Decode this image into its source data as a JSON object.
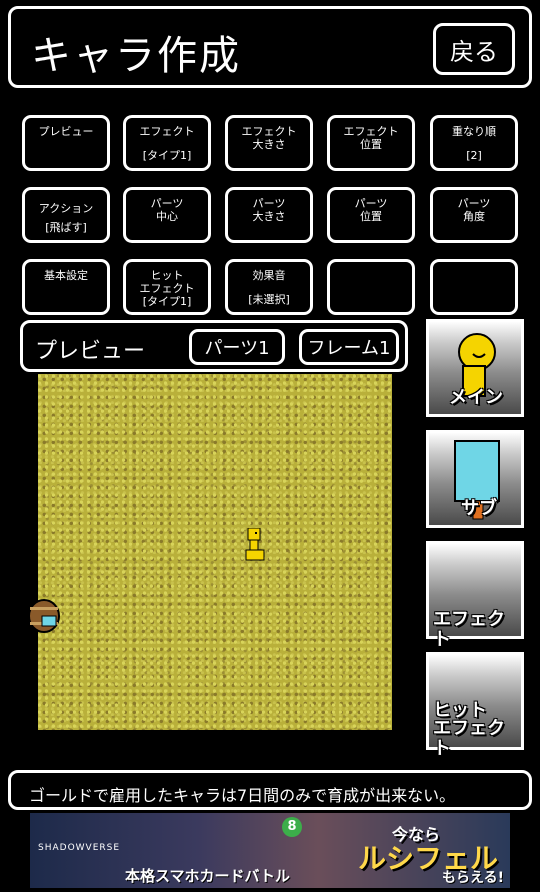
{
  "header": {
    "title": "キャラ作成",
    "back_label": "戻る"
  },
  "grid_buttons": [
    {
      "line1": "プレビュー",
      "line2": ""
    },
    {
      "line1": "エフェクト",
      "line2": "[タイプ1]"
    },
    {
      "line1": "エフェクト\n大きさ",
      "line2": ""
    },
    {
      "line1": "エフェクト\n位置",
      "line2": ""
    },
    {
      "line1": "重なり順",
      "line2": "[2]"
    },
    {
      "line1": "アクション",
      "line2": "[飛ばす]"
    },
    {
      "line1": "パーツ\n中心",
      "line2": ""
    },
    {
      "line1": "パーツ\n大きさ",
      "line2": ""
    },
    {
      "line1": "パーツ\n位置",
      "line2": ""
    },
    {
      "line1": "パーツ\n角度",
      "line2": ""
    },
    {
      "line1": "基本設定",
      "line2": ""
    },
    {
      "line1": "ヒット\nエフェクト",
      "line2": "[タイプ1]"
    },
    {
      "line1": "効果音",
      "line2": "[未選択]"
    },
    {
      "line1": "",
      "line2": ""
    },
    {
      "line1": "",
      "line2": ""
    }
  ],
  "preview": {
    "label": "プレビュー",
    "parts_btn": "パーツ1",
    "frame_btn": "フレーム1"
  },
  "side_buttons": {
    "main": "メイン",
    "sub": "サブ",
    "effect": "エフェクト",
    "hit_effect_1": "ヒット",
    "hit_effect_2": "エフェクト"
  },
  "message": "ゴールドで雇用したキャラは7日間のみで育成が出来ない。",
  "ad": {
    "logo": "SHADOWVERSE",
    "main": "本格スマホカードバトル",
    "r1": "今なら",
    "r2": "ルシフェル",
    "r3": "もらえる!",
    "badge": "8"
  },
  "colors": {
    "field": "#b9b03a",
    "accent_yellow": "#f5d400",
    "accent_cyan": "#6fd6e6"
  }
}
